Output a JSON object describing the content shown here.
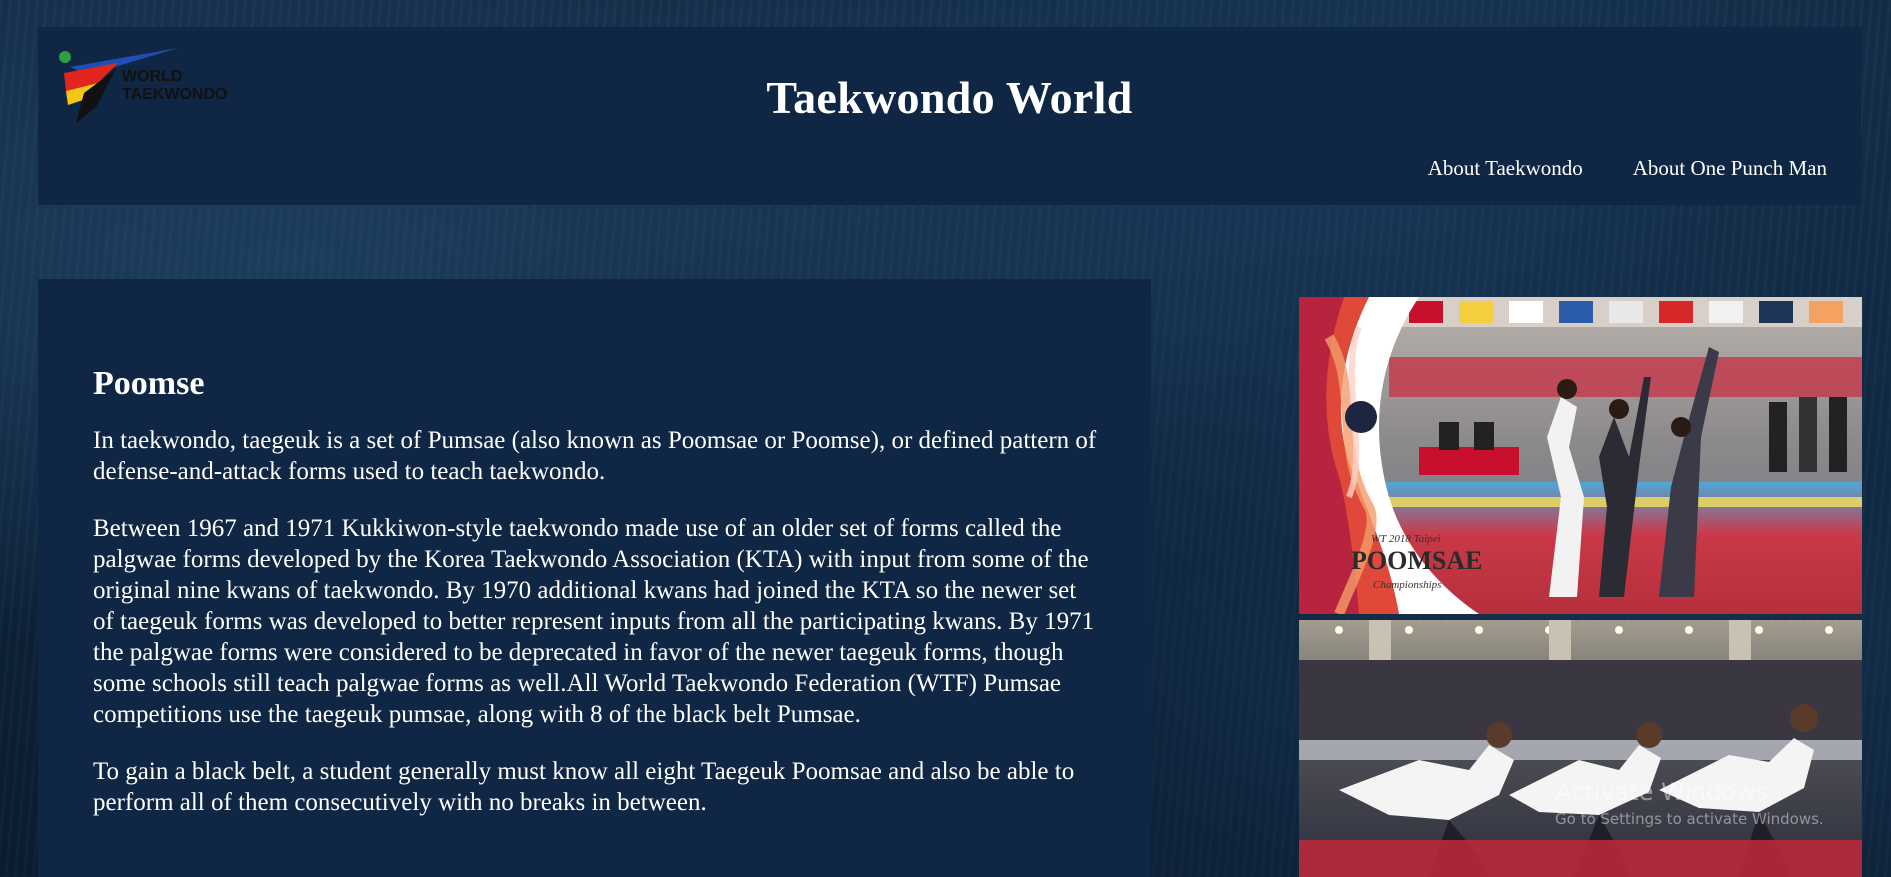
{
  "header": {
    "logo_text_line1": "WORLD",
    "logo_text_line2": "TAEKWONDO",
    "title": "Taekwondo World",
    "nav": [
      {
        "label": "About Taekwondo"
      },
      {
        "label": "About One Punch Man"
      }
    ]
  },
  "article": {
    "heading": "Poomse",
    "paragraphs": [
      "In taekwondo, taegeuk is a set of Pumsae (also known as Poomsae or Poomse), or defined pattern of defense-and-attack forms used to teach taekwondo.",
      "Between 1967 and 1971 Kukkiwon-style taekwondo made use of an older set of forms called the palgwae forms developed by the Korea Taekwondo Association (KTA) with input from some of the original nine kwans of taekwondo. By 1970 additional kwans had joined the KTA so the newer set of taegeuk forms was developed to better represent inputs from all the participating kwans. By 1971 the palgwae forms were considered to be deprecated in favor of the newer taegeuk forms, though some schools still teach palgwae forms as well.All World Taekwondo Federation (WTF) Pumsae competitions use the taegeuk pumsae, along with 8 of the black belt Pumsae.",
      "To gain a black belt, a student generally must know all eight Taegeuk Poomsae and also be able to perform all of them consecutively with no breaks in between."
    ]
  },
  "images": {
    "photo1_caption_line1": "WT 2018 Taipei",
    "photo1_caption_line2": "POOMSAE",
    "photo1_caption_line3": "Championships"
  },
  "watermark": {
    "title": "Activate Windows",
    "subtitle": "Go to Settings to activate Windows."
  },
  "colors": {
    "panel": "#0f2644",
    "text": "#ffffff",
    "background": "#0d2238"
  }
}
